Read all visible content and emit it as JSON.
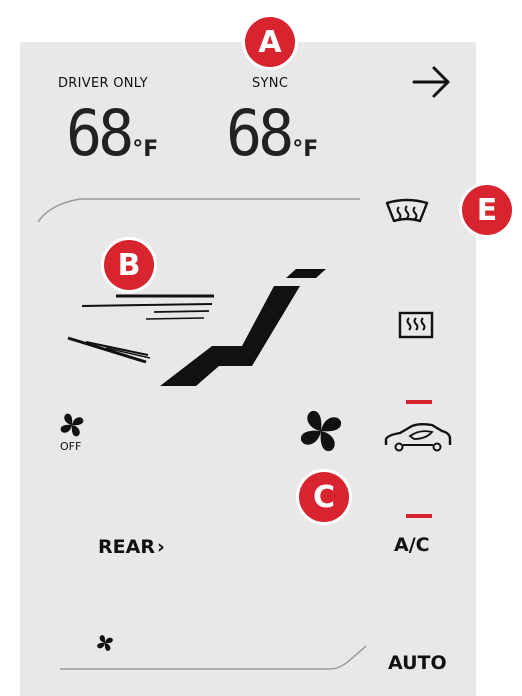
{
  "driver_only_label": "DRIVER ONLY",
  "sync_label": "SYNC",
  "left_temp": "68",
  "right_temp": "68",
  "temp_unit": "°F",
  "fan_off_label": "OFF",
  "rear_label": "REAR",
  "rear_chevron": "›",
  "ac_label": "A/C",
  "auto_label": "AUTO",
  "callouts": {
    "a": "A",
    "b": "B",
    "c": "C",
    "e": "E"
  },
  "colors": {
    "panel": "#e8e8e8",
    "callout": "#d8242f",
    "text": "#111111",
    "indicator": "#d8242f"
  },
  "icons": {
    "arrow": "arrow-right-icon",
    "front_defrost": "windshield-defrost-icon",
    "rear_defrost": "rear-defrost-icon",
    "airflow": "airflow-mode-icon",
    "fan_small": "fan-icon",
    "fan_large": "fan-speed-icon",
    "recirc": "recirculation-car-icon"
  }
}
